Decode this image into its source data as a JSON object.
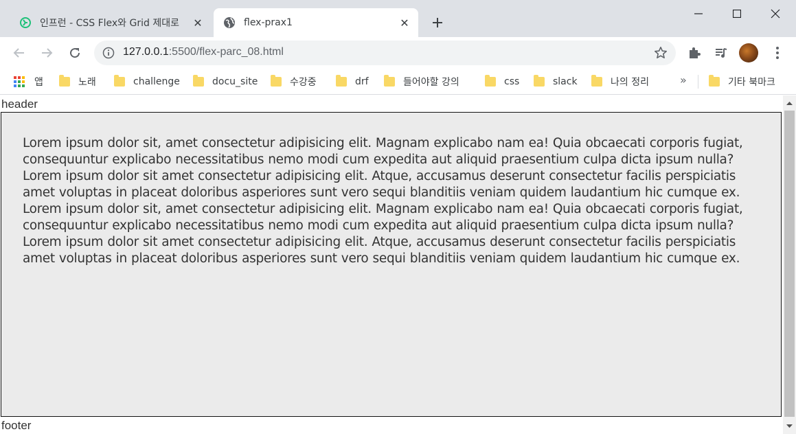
{
  "tabs": [
    {
      "title": "인프런 - CSS Flex와 Grid 제대로",
      "active": false
    },
    {
      "title": "flex-prax1",
      "active": true
    }
  ],
  "toolbar": {
    "url_host": "127.0.0.1",
    "url_rest": ":5500/flex-parc_08.html"
  },
  "bookmarks": {
    "apps_label": "앱",
    "items": [
      "노래",
      "challenge",
      "docu_site",
      "수강중",
      "drf",
      "들어야할 강의",
      "css",
      "slack",
      "나의 정리"
    ],
    "overflow_label": "»",
    "other_label": "기타 북마크"
  },
  "page": {
    "header": "header",
    "paragraph": "Lorem ipsum dolor sit, amet consectetur adipisicing elit. Magnam explicabo nam ea! Quia obcaecati corporis fugiat, consequuntur explicabo necessitatibus nemo modi cum expedita aut aliquid praesentium culpa dicta ipsum nulla? Lorem ipsum dolor sit amet consectetur adipisicing elit. Atque, accusamus deserunt consectetur facilis perspiciatis amet voluptas in placeat doloribus asperiores sunt vero sequi blanditiis veniam quidem laudantium hic cumque ex. Lorem ipsum dolor sit, amet consectetur adipisicing elit. Magnam explicabo nam ea! Quia obcaecati corporis fugiat, consequuntur explicabo necessitatibus nemo modi cum expedita aut aliquid praesentium culpa dicta ipsum nulla? Lorem ipsum dolor sit amet consectetur adipisicing elit. Atque, accusamus deserunt consectetur facilis perspiciatis amet voluptas in placeat doloribus asperiores sunt vero sequi blanditiis veniam quidem laudantium hic cumque ex.",
    "footer": "footer"
  },
  "colors": {
    "tabstrip_bg": "#dee1e6",
    "omnibox_bg": "#f1f3f4",
    "folder": "#f9d865",
    "main_bg": "#ebebeb",
    "inflearn_green": "#1dc078"
  },
  "icons": [
    "inflearn-favicon",
    "globe-icon",
    "close-icon",
    "plus-icon",
    "minimize-icon",
    "maximize-icon",
    "window-close-icon",
    "back-arrow-icon",
    "forward-arrow-icon",
    "reload-icon",
    "info-icon",
    "star-icon",
    "puzzle-icon",
    "media-queue-icon",
    "kebab-menu-icon",
    "apps-grid-icon",
    "folder-icon"
  ]
}
